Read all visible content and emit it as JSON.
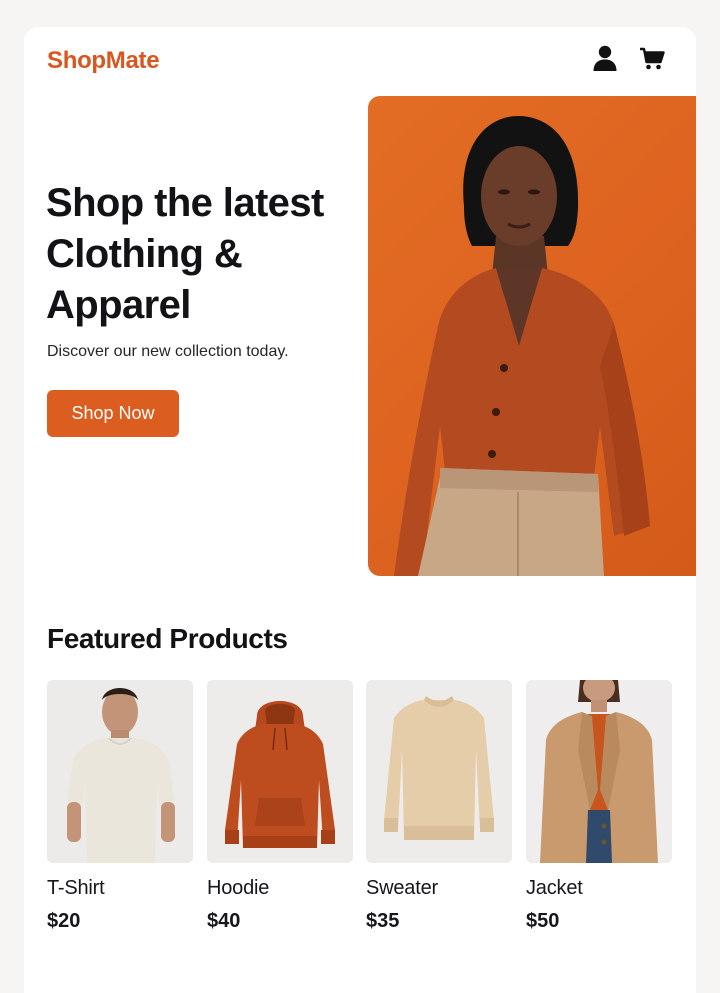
{
  "header": {
    "logo": "ShopMate",
    "icons": {
      "account": "user-icon",
      "cart": "cart-icon"
    }
  },
  "hero": {
    "title_lines": [
      "Shop the latest",
      "Clothing &",
      "Apparel"
    ],
    "subtitle": "Discover our new collection today.",
    "cta_label": "Shop Now",
    "image": "woman-in-orange-cardigan-photo"
  },
  "featured": {
    "title": "Featured Products",
    "products": [
      {
        "name": "T-Shirt",
        "price": "$20",
        "image": "man-in-white-tshirt-photo"
      },
      {
        "name": "Hoodie",
        "price": "$40",
        "image": "orange-hoodie-photo"
      },
      {
        "name": "Sweater",
        "price": "$35",
        "image": "beige-sweater-photo"
      },
      {
        "name": "Jacket",
        "price": "$50",
        "image": "woman-in-tan-blazer-photo"
      }
    ]
  },
  "colors": {
    "brand": "#d9561f",
    "button": "#dc5d20",
    "hero_bg": "#e06822",
    "text": "#121316"
  }
}
